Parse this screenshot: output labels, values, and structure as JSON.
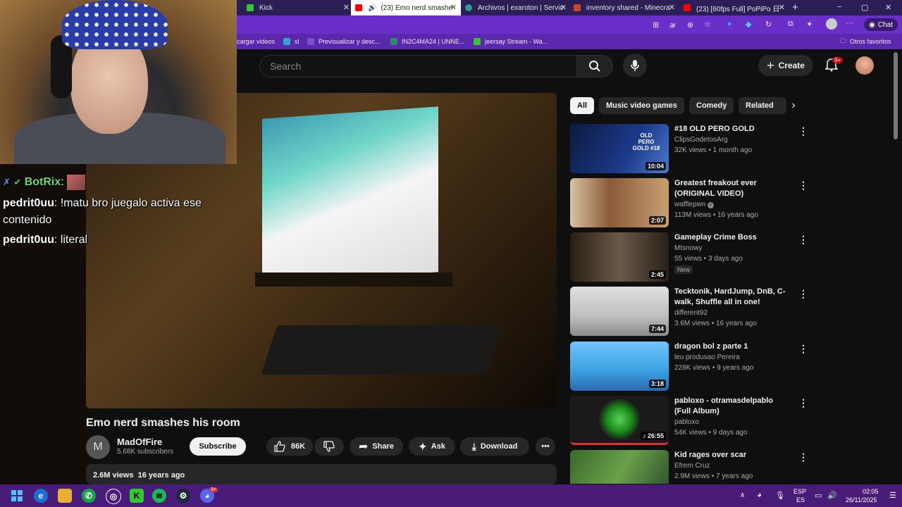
{
  "browser": {
    "tabs": [
      {
        "label": "Kick",
        "active": false
      },
      {
        "label": "(23) Emo nerd smashe",
        "active": true
      },
      {
        "label": "Archivos | exaroton | Servic",
        "active": false
      },
      {
        "label": "inventory shared - Minecra",
        "active": false
      },
      {
        "label": "(23) [60fps Full] PoPiPo 日",
        "active": false
      }
    ],
    "new_tab": "+",
    "window_controls": {
      "minimize": "−",
      "maximize": "▢",
      "close": "✕"
    },
    "chat_button": "Chat",
    "bookmarks": [
      {
        "label": "cargar videos",
        "color": "#3b3b3b"
      },
      {
        "label": "sl",
        "color": "#2ea9c8"
      },
      {
        "label": "Previsualizar y desc...",
        "color": "#7a4fd0"
      },
      {
        "label": "IN2C4MA24 | UNNE...",
        "color": "#2a8a6a"
      },
      {
        "label": "jeersay Stream - Wa...",
        "color": "#32c832"
      }
    ],
    "other_favorites": "Otros favoritos"
  },
  "youtube": {
    "search_placeholder": "Search",
    "create_label": "Create",
    "notifications_badge": "9+",
    "chips": [
      "All",
      "Music video games",
      "Comedy",
      "Related"
    ],
    "video": {
      "title": "Emo nerd smashes his room",
      "channel": "MadOfFire",
      "channel_initial": "M",
      "subscribers": "5.68K subscribers",
      "subscribe_label": "Subscribe",
      "likes": "86K",
      "share_label": "Share",
      "ask_label": "Ask",
      "download_label": "Download",
      "views": "2.6M views",
      "age": "16 years ago"
    },
    "recommendations": [
      {
        "title": "#18 OLD PERO GOLD",
        "channel": "ClipsGodetosArg",
        "meta": "32K views • 1 month ago",
        "duration": "10:04",
        "thumb_text": "OLD PERO GOLD #18",
        "thumb_color": "#1d3a8a"
      },
      {
        "title": "Greatest freakout ever (ORIGINAL VIDEO)",
        "channel": "wafflepwn",
        "meta": "113M views • 16 years ago",
        "duration": "2:07",
        "thumb_color": "#8a5a3a",
        "verified": true
      },
      {
        "title": "Gameplay Crime Boss",
        "channel": "Mtsnowy",
        "meta": "55 views • 3 days ago",
        "duration": "2:45",
        "thumb_color": "#4a3a2a",
        "badge": "New"
      },
      {
        "title": "Tecktonik, HardJump, DnB, C-walk, Shuffle all in one!",
        "channel": "different92",
        "meta": "3.6M views • 16 years ago",
        "duration": "7:44",
        "thumb_color": "#bfbfbf"
      },
      {
        "title": "dragon bol z parte 1",
        "channel": "leu produsao Pereira",
        "meta": "228K views • 9 years ago",
        "duration": "3:18",
        "thumb_color": "#3aa0e0"
      },
      {
        "title": "pabloxo - otramasdelpablo (Full Album)",
        "channel": "pabloxo",
        "meta": "54K views • 9 days ago",
        "duration": "26:55",
        "thumb_color": "#1a1a1a"
      },
      {
        "title": "Kid rages over scar",
        "channel": "Efrem Cruz",
        "meta": "2.9M views • 7 years ago",
        "duration": "",
        "thumb_color": "#4a8a3a"
      }
    ]
  },
  "stream_overlay": {
    "chat": [
      {
        "user": "BotRix",
        "message": "",
        "color": "#6bd96b"
      },
      {
        "user": "pedrit0uu",
        "message": "!matu bro juegalo activa ese",
        "color": "#ffffff"
      },
      {
        "user": "",
        "message": "contenido",
        "color": "#ffffff"
      },
      {
        "user": "pedrit0uu",
        "message": "literal",
        "color": "#ffffff"
      }
    ]
  },
  "taskbar": {
    "language": "ESP",
    "language_sub": "ES",
    "time": "02:05",
    "date": "26/11/2025",
    "discord_badge": "9+"
  }
}
